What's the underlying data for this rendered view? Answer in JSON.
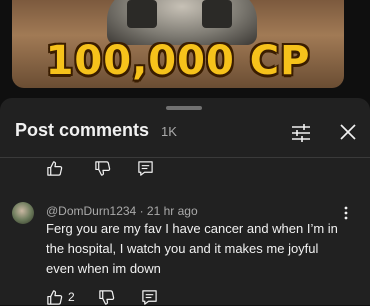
{
  "thumbnail": {
    "overlay_text": "100,000 CP"
  },
  "panel": {
    "title": "Post comments",
    "count": "1K",
    "filter_icon": "sliders-icon",
    "close_icon": "close-icon"
  },
  "prev_comment": {
    "like_icon": "thumbs-up-icon",
    "dislike_icon": "thumbs-down-icon",
    "reply_icon": "reply-icon"
  },
  "comment": {
    "author": "@DomDurn1234",
    "separator": "·",
    "time": "21 hr ago",
    "text": "Ferg you are my fav I have cancer and when I’m in the hospital, I watch you and it makes me joyful even when im down",
    "likes": "2",
    "more_icon": "more-vert-icon"
  },
  "colors": {
    "background": "#0f0f0f",
    "sheet": "#212121",
    "primary_text": "#f1f1f1",
    "secondary_text": "#aaaaaa",
    "thumbnail_text": "#f6c21b"
  }
}
